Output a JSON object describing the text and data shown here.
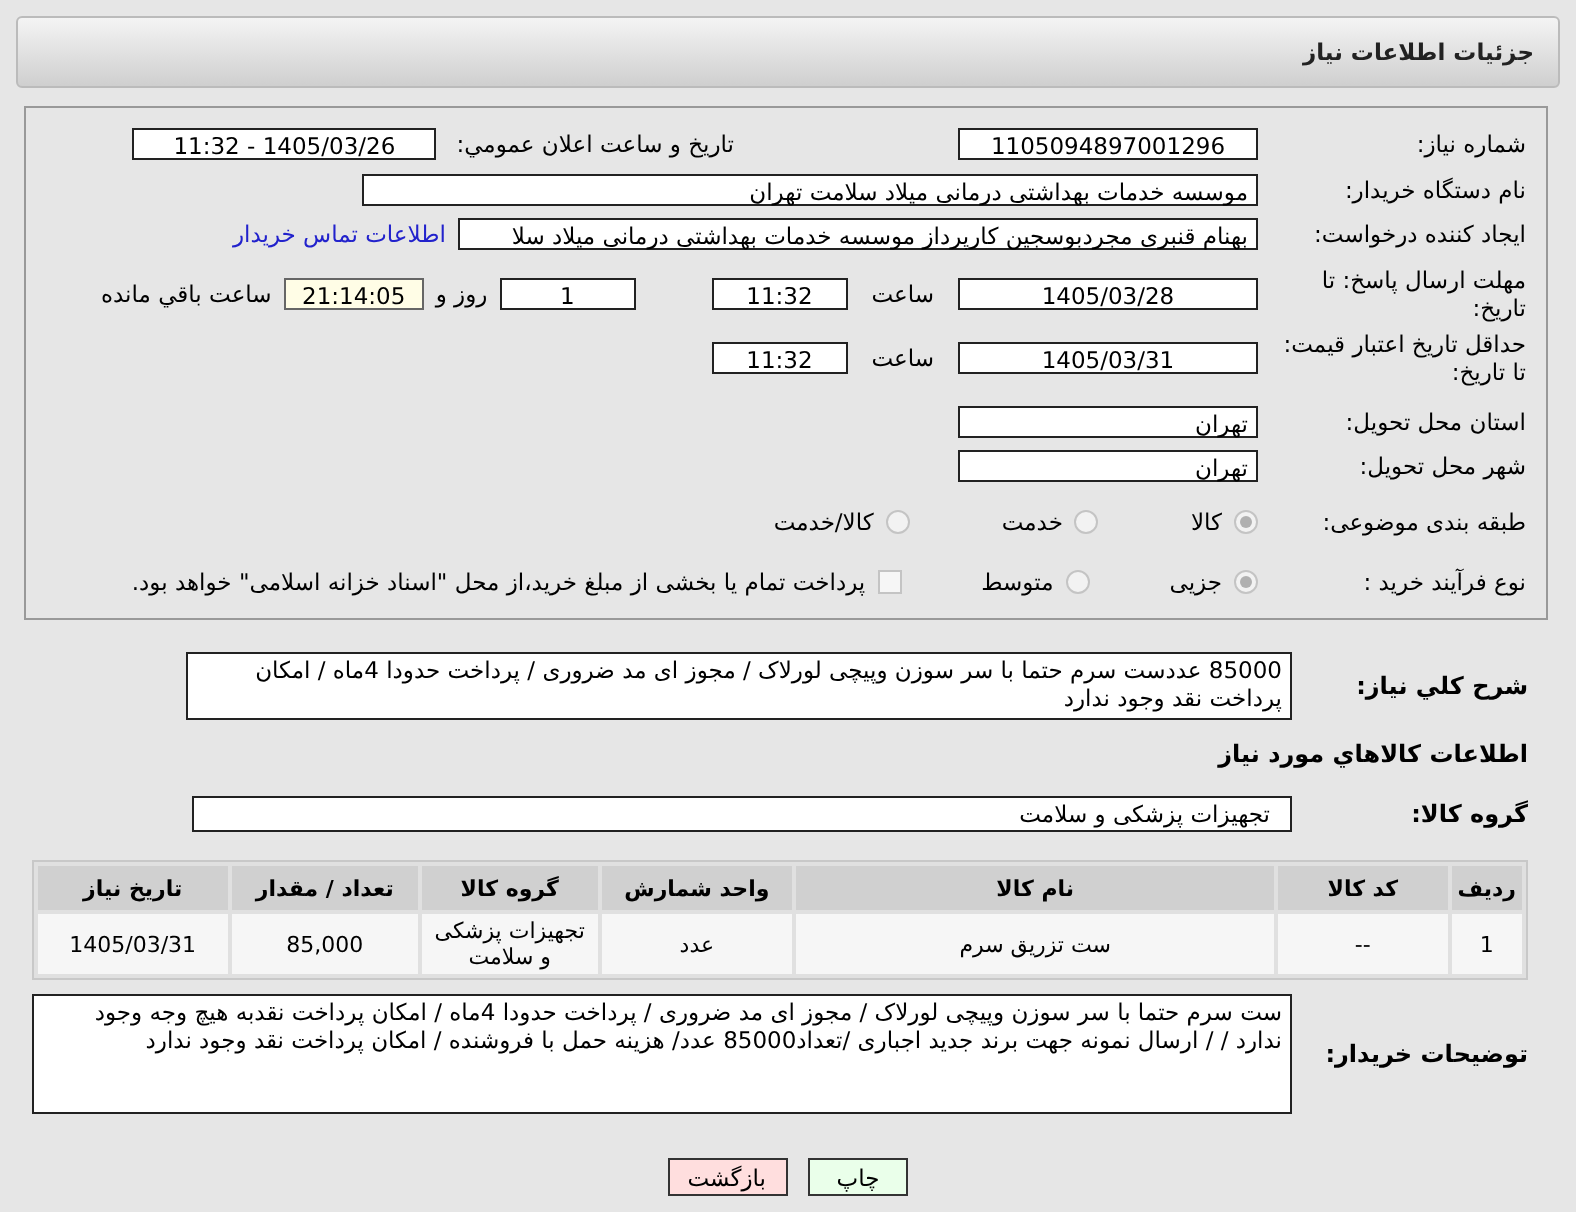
{
  "header": {
    "title": "جزئیات اطلاعات نیاز"
  },
  "need_number": {
    "label": "شماره نیاز:",
    "value": "1105094897001296"
  },
  "announce": {
    "label": "تاریخ و ساعت اعلان عمومي:",
    "value": "1405/03/26 - 11:32"
  },
  "buyer_org": {
    "label": "نام دستگاه خریدار:",
    "value": "موسسه خدمات بهداشتی درمانی میلاد سلامت تهران"
  },
  "requester": {
    "label": "ایجاد کننده درخواست:",
    "value": "بهنام قنبری مجردبوسجین کارپرداز موسسه خدمات بهداشتی درمانی میلاد سلا",
    "link": "اطلاعات تماس خریدار"
  },
  "deadline": {
    "label": "مهلت ارسال پاسخ: تا تاریخ:",
    "date": "1405/03/28",
    "time_label": "ساعت",
    "time": "11:32",
    "days": "1",
    "days_label": "روز و",
    "remaining": "21:14:05",
    "remaining_label": "ساعت باقي مانده"
  },
  "price_validity": {
    "label": "حداقل تاریخ اعتبار قیمت: تا تاریخ:",
    "date": "1405/03/31",
    "time_label": "ساعت",
    "time": "11:32"
  },
  "province": {
    "label": "استان محل تحویل:",
    "value": "تهران"
  },
  "city": {
    "label": "شهر محل تحویل:",
    "value": "تهران"
  },
  "category": {
    "label": "طبقه بندی موضوعی:",
    "options": [
      {
        "label": "کالا",
        "selected": true
      },
      {
        "label": "خدمت",
        "selected": false
      },
      {
        "label": "کالا/خدمت",
        "selected": false
      }
    ]
  },
  "process": {
    "label": "نوع فرآیند خرید :",
    "options": [
      {
        "label": "جزیی",
        "selected": true
      },
      {
        "label": "متوسط",
        "selected": false
      }
    ],
    "treasury": {
      "label": "پرداخت تمام یا بخشی از مبلغ خرید،از محل \"اسناد خزانه اسلامی\" خواهد بود.",
      "checked": false
    }
  },
  "description": {
    "label": "شرح کلي نیاز:",
    "value": "85000 عددست سرم حتما با سر سوزن  وپیچی لورلاک / مجوز ای مد ضروری / پرداخت حدودا  4ماه / امکان پرداخت نقد وجود ندارد"
  },
  "goods_title": "اطلاعات کالاهاي مورد نیاز",
  "goods_group": {
    "label": "گروه کالا:",
    "value": "تجهیزات پزشکی و سلامت"
  },
  "table": {
    "columns": [
      "ردیف",
      "کد کالا",
      "نام کالا",
      "واحد شمارش",
      "گروه کالا",
      "تعداد / مقدار",
      "تاریخ نیاز"
    ],
    "rows": [
      [
        "1",
        "--",
        "ست تزریق سرم",
        "عدد",
        "تجهیزات پزشکی و سلامت",
        "85,000",
        "1405/03/31"
      ]
    ]
  },
  "buyer_notes": {
    "label": "توضیحات خریدار:",
    "value": "ست سرم حتما با سر سوزن  وپیچی لورلاک / مجوز ای مد ضروری / پرداخت حدودا  4ماه / امکان پرداخت نقدبه هیچ وجه وجود ندارد /  / ارسال نمونه جهت  برند  جدید اجباری /تعداد85000 عدد/ هزینه حمل با فروشنده  /  امکان پرداخت نقد وجود ندارد"
  },
  "buttons": [
    {
      "label": "چاپ",
      "kind": "print"
    },
    {
      "label": "بازگشت",
      "kind": "back"
    }
  ]
}
